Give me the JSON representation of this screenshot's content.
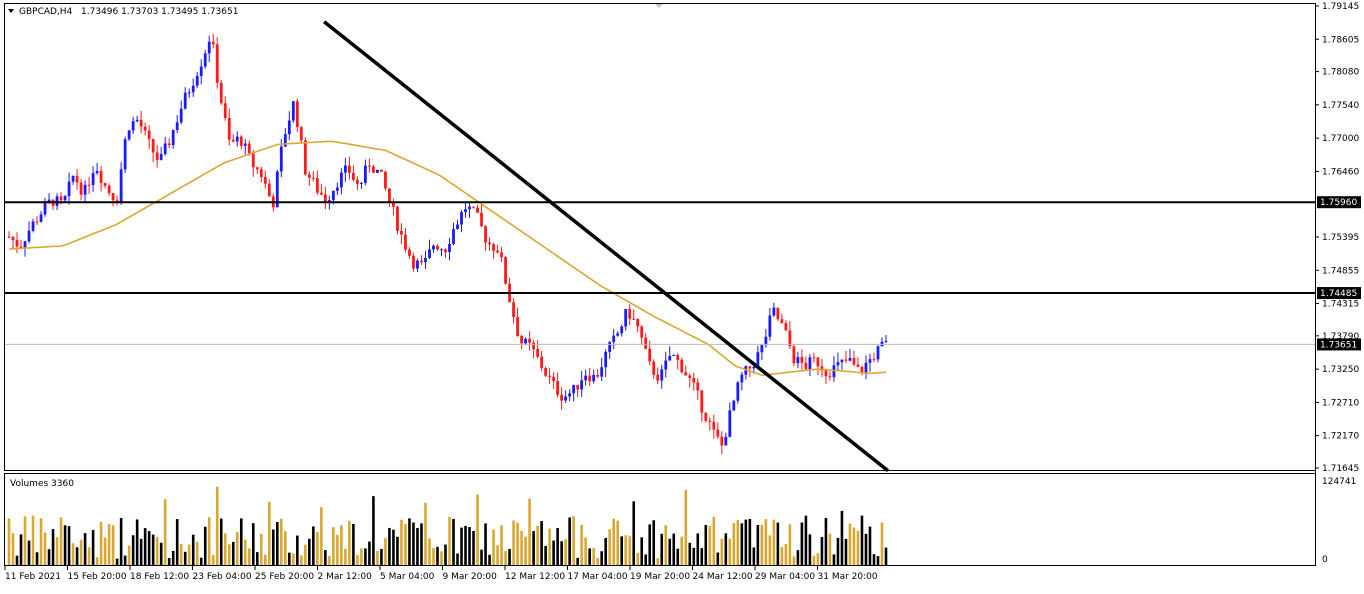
{
  "header": {
    "symbol_label": "GBPCAD,H4",
    "ohlc_label": "1.73496 1.73703 1.73495 1.73651"
  },
  "volume_panel": {
    "label": "Volumes 3360",
    "max_label": "124741",
    "zero_label": "0"
  },
  "colors": {
    "bull": "#1a1aff",
    "bear": "#ff1a1a",
    "ma": "#d9a830",
    "vol_up": "#000000",
    "vol_down": "#d9a830",
    "line": "#000000",
    "grid_price": "#bbbbbb"
  },
  "chart_data": {
    "type": "candlestick",
    "symbol": "GBPCAD",
    "timeframe": "H4",
    "ylim": [
      1.71645,
      1.79145
    ],
    "y_ticks": [
      "1.79145",
      "1.78605",
      "1.78080",
      "1.77540",
      "1.77000",
      "1.76460",
      "1.75395",
      "1.74855",
      "1.74315",
      "1.73790",
      "1.73250",
      "1.72710",
      "1.72170",
      "1.71645"
    ],
    "x_ticks": [
      "11 Feb 2021",
      "15 Feb 20:00",
      "18 Feb 12:00",
      "23 Feb 04:00",
      "25 Feb 20:00",
      "2 Mar 12:00",
      "5 Mar 04:00",
      "9 Mar 20:00",
      "12 Mar 12:00",
      "17 Mar 04:00",
      "19 Mar 20:00",
      "24 Mar 12:00",
      "29 Mar 04:00",
      "31 Mar 20:00"
    ],
    "horizontal_levels": [
      {
        "label": "1.75960",
        "value": 1.7596
      },
      {
        "label": "1.74485",
        "value": 1.74485
      }
    ],
    "current_price": {
      "label": "1.73651",
      "value": 1.73651
    },
    "trendline": {
      "start": {
        "bar": 0.36,
        "price": 1.7889
      },
      "end": {
        "bar": 1.0,
        "price": 1.716
      }
    },
    "price_path": [
      [
        0,
        1.754
      ],
      [
        4,
        1.7525
      ],
      [
        8,
        1.7555
      ],
      [
        12,
        1.758
      ],
      [
        16,
        1.76
      ],
      [
        20,
        1.759
      ],
      [
        24,
        1.764
      ],
      [
        28,
        1.761
      ],
      [
        32,
        1.766
      ],
      [
        36,
        1.762
      ],
      [
        40,
        1.76
      ],
      [
        44,
        1.772
      ],
      [
        48,
        1.773
      ],
      [
        52,
        1.769
      ],
      [
        56,
        1.766
      ],
      [
        60,
        1.77
      ],
      [
        64,
        1.775
      ],
      [
        68,
        1.779
      ],
      [
        72,
        1.783
      ],
      [
        75,
        1.787
      ],
      [
        78,
        1.778
      ],
      [
        82,
        1.769
      ],
      [
        86,
        1.77
      ],
      [
        90,
        1.766
      ],
      [
        94,
        1.764
      ],
      [
        98,
        1.759
      ],
      [
        102,
        1.77
      ],
      [
        106,
        1.776
      ],
      [
        110,
        1.765
      ],
      [
        114,
        1.762
      ],
      [
        118,
        1.76
      ],
      [
        122,
        1.763
      ],
      [
        126,
        1.765
      ],
      [
        130,
        1.762
      ],
      [
        134,
        1.766
      ],
      [
        138,
        1.764
      ],
      [
        142,
        1.759
      ],
      [
        146,
        1.754
      ],
      [
        150,
        1.75
      ],
      [
        154,
        1.749
      ],
      [
        158,
        1.753
      ],
      [
        162,
        1.752
      ],
      [
        166,
        1.756
      ],
      [
        170,
        1.759
      ],
      [
        174,
        1.757
      ],
      [
        178,
        1.753
      ],
      [
        182,
        1.752
      ],
      [
        186,
        1.744
      ],
      [
        190,
        1.737
      ],
      [
        194,
        1.736
      ],
      [
        198,
        1.733
      ],
      [
        202,
        1.73
      ],
      [
        206,
        1.728
      ],
      [
        210,
        1.729
      ],
      [
        214,
        1.732
      ],
      [
        218,
        1.731
      ],
      [
        222,
        1.735
      ],
      [
        226,
        1.738
      ],
      [
        230,
        1.742
      ],
      [
        234,
        1.739
      ],
      [
        238,
        1.733
      ],
      [
        242,
        1.731
      ],
      [
        246,
        1.735
      ],
      [
        250,
        1.733
      ],
      [
        254,
        1.73
      ],
      [
        258,
        1.726
      ],
      [
        262,
        1.722
      ],
      [
        265,
        1.72
      ],
      [
        268,
        1.725
      ],
      [
        272,
        1.731
      ],
      [
        276,
        1.733
      ],
      [
        280,
        1.736
      ],
      [
        284,
        1.742
      ],
      [
        288,
        1.739
      ],
      [
        292,
        1.734
      ],
      [
        296,
        1.733
      ],
      [
        300,
        1.734
      ],
      [
        304,
        1.732
      ],
      [
        308,
        1.733
      ],
      [
        312,
        1.734
      ],
      [
        316,
        1.732
      ],
      [
        320,
        1.734
      ],
      [
        324,
        1.736
      ],
      [
        326,
        1.7365
      ]
    ],
    "ma_path": [
      [
        0,
        1.752
      ],
      [
        20,
        1.7525
      ],
      [
        40,
        1.756
      ],
      [
        60,
        1.761
      ],
      [
        80,
        1.766
      ],
      [
        100,
        1.769
      ],
      [
        120,
        1.7695
      ],
      [
        140,
        1.768
      ],
      [
        160,
        1.764
      ],
      [
        180,
        1.758
      ],
      [
        200,
        1.752
      ],
      [
        220,
        1.746
      ],
      [
        240,
        1.741
      ],
      [
        260,
        1.7365
      ],
      [
        270,
        1.733
      ],
      [
        280,
        1.7315
      ],
      [
        290,
        1.732
      ],
      [
        300,
        1.7325
      ],
      [
        310,
        1.7322
      ],
      [
        320,
        1.7318
      ],
      [
        326,
        1.732
      ]
    ]
  }
}
